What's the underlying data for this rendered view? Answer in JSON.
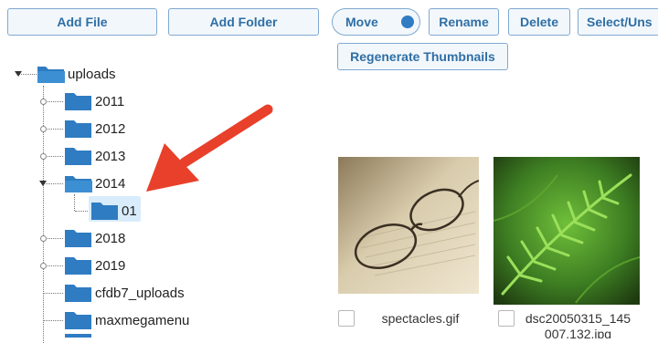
{
  "toolbar": {
    "add_file": "Add File",
    "add_folder": "Add Folder",
    "move": "Move",
    "rename": "Rename",
    "delete": "Delete",
    "select_unselect": "Select/Uns",
    "regenerate_thumbnails": "Regenerate Thumbnails"
  },
  "tree": {
    "root": "uploads",
    "items": [
      "2011",
      "2012",
      "2013",
      "2014",
      "01",
      "2018",
      "2019",
      "cfdb7_uploads",
      "maxmegamenu"
    ],
    "selected": "01"
  },
  "files": [
    {
      "name": "spectacles.gif"
    },
    {
      "name_line1": "dsc20050315_145",
      "name_line2": "007.132.jpg"
    }
  ],
  "colors": {
    "accent": "#2f6fa6",
    "folder": "#2f7cc2",
    "arrow": "#e8402a",
    "selection": "#d9ecfb"
  }
}
